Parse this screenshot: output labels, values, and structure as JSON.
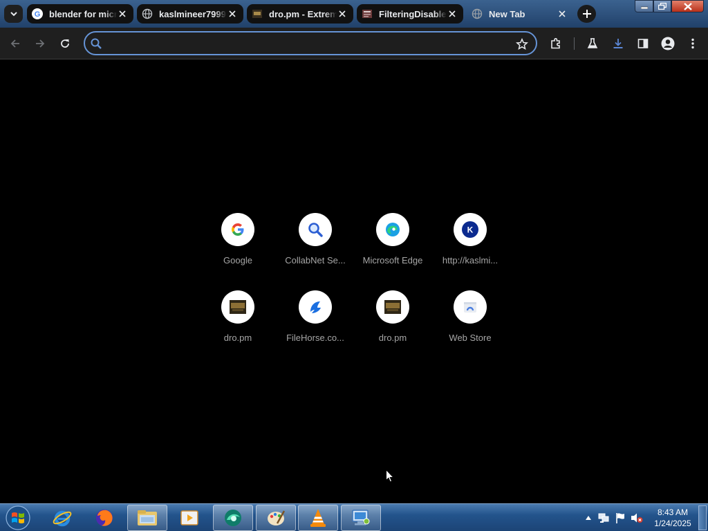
{
  "browser": {
    "tabs": [
      {
        "title": "blender for micr",
        "favicon": "google-g-icon",
        "active": false
      },
      {
        "title": "kaslmineer7999",
        "favicon": "globe-icon",
        "active": false
      },
      {
        "title": "dro.pm - Extrem",
        "favicon": "dro-pm-icon",
        "active": false
      },
      {
        "title": "FilteringDisable",
        "favicon": "document-icon",
        "active": false
      },
      {
        "title": "New Tab",
        "favicon": "globe-icon",
        "active": true
      }
    ],
    "omnibox": {
      "value": "",
      "placeholder": ""
    }
  },
  "new_tab": {
    "shortcuts": [
      {
        "label": "Google",
        "icon": "google-g-icon"
      },
      {
        "label": "CollabNet Se...",
        "icon": "magnifier-icon"
      },
      {
        "label": "Microsoft Edge",
        "icon": "edge-icon"
      },
      {
        "label": "http://kaslmi...",
        "icon": "k-letter-icon",
        "letter": "K"
      },
      {
        "label": "dro.pm",
        "icon": "dro-pm-icon"
      },
      {
        "label": "FileHorse.co...",
        "icon": "filehorse-icon"
      },
      {
        "label": "dro.pm",
        "icon": "dro-pm-icon"
      },
      {
        "label": "Web Store",
        "icon": "web-store-icon"
      }
    ]
  },
  "taskbar": {
    "apps": [
      "internet-explorer-icon",
      "firefox-icon",
      "file-explorer-icon",
      "media-player-icon",
      "browser-app-icon",
      "paint-icon",
      "vlc-icon",
      "remote-desktop-icon"
    ],
    "clock": {
      "time": "8:43 AM",
      "date": "1/24/2025"
    }
  },
  "colors": {
    "accent": "#6694d7",
    "toolbar_bg": "#1f1f1f",
    "page_bg": "#000000",
    "download_icon": "#5b87d6"
  }
}
